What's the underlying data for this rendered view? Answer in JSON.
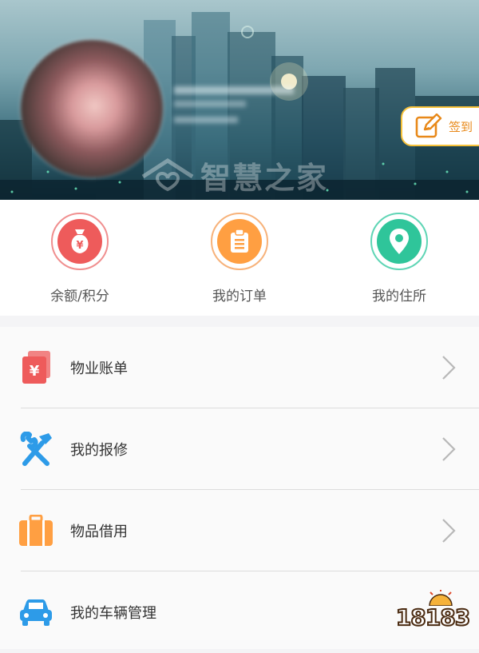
{
  "header": {
    "watermark_text": "智慧之家",
    "sign_in_label": "签到"
  },
  "quick_actions": [
    {
      "label": "余额/积分",
      "icon": "money-bag-icon",
      "color": "#ee5b5b"
    },
    {
      "label": "我的订单",
      "icon": "clipboard-icon",
      "color": "#ff9f42"
    },
    {
      "label": "我的住所",
      "icon": "location-pin-icon",
      "color": "#2fc59a"
    }
  ],
  "menu": [
    {
      "label": "物业账单",
      "icon": "bill-icon",
      "color": "#ee5b5b"
    },
    {
      "label": "我的报修",
      "icon": "repair-tools-icon",
      "color": "#2d9be8"
    },
    {
      "label": "物品借用",
      "icon": "suitcase-icon",
      "color": "#ff9f42"
    },
    {
      "label": "我的车辆管理",
      "icon": "car-icon",
      "color": "#2d9be8"
    }
  ],
  "watermark_logo": {
    "text": "18183"
  }
}
